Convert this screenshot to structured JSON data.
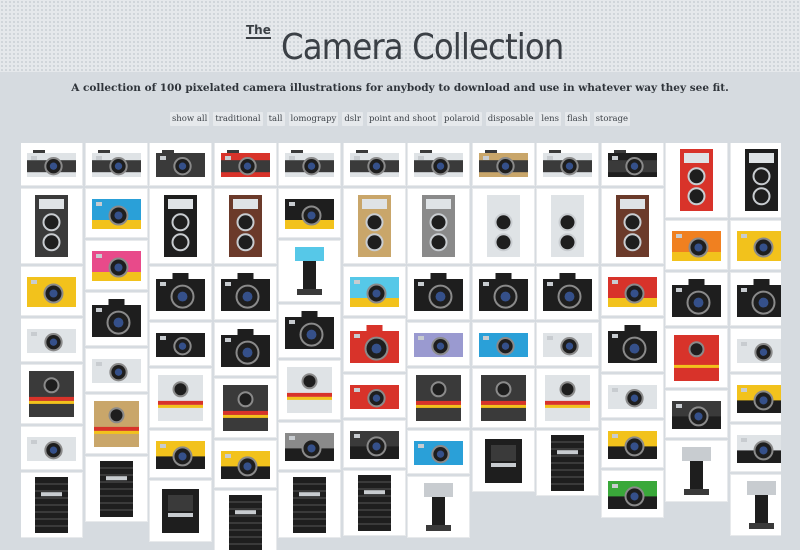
{
  "header": {
    "title_prefix": "The",
    "title": "Camera Collection",
    "tagline": "A collection of 100 pixelated camera illustrations for anybody to download and use in whatever way they see fit."
  },
  "filters": [
    "show all",
    "traditional",
    "tall",
    "lomograpy",
    "dslr",
    "point and shoot",
    "polaroid",
    "disposable",
    "lens",
    "flash",
    "storage"
  ],
  "colors": {
    "black": "#1e1e1e",
    "dark": "#3a3a3a",
    "gray": "#8a8a8a",
    "light": "#c8ccd0",
    "silver": "#dfe3e6",
    "blue": "#2aa0d8",
    "cyan": "#56c8e8",
    "red": "#d8332a",
    "orange": "#f08020",
    "yellow": "#f2c21c",
    "pink": "#e84a8a",
    "green": "#3aa83a",
    "beige": "#c9a66a",
    "brown": "#6b3a2a",
    "lavender": "#9a9ad0"
  },
  "gallery": {
    "columns": [
      [
        {
          "k": "rangefinder",
          "c": "silver"
        },
        {
          "k": "tlr",
          "c": "dark"
        },
        {
          "k": "lomo",
          "c": "yellow"
        },
        {
          "k": "pns",
          "c": "silver"
        },
        {
          "k": "polaroid",
          "c": "dark"
        },
        {
          "k": "pns",
          "c": "silver"
        },
        {
          "k": "lens",
          "c": "black"
        }
      ],
      [
        {
          "k": "rangefinder",
          "c": "silver"
        },
        {
          "k": "lomo",
          "c": "blue"
        },
        {
          "k": "lomo",
          "c": "pink"
        },
        {
          "k": "dslr",
          "c": "black"
        },
        {
          "k": "pns",
          "c": "silver"
        },
        {
          "k": "polaroid",
          "c": "beige"
        },
        {
          "k": "lens",
          "c": "black"
        }
      ],
      [
        {
          "k": "rangefinder",
          "c": "dark"
        },
        {
          "k": "tlr",
          "c": "black"
        },
        {
          "k": "dslr",
          "c": "black"
        },
        {
          "k": "pns",
          "c": "black"
        },
        {
          "k": "polaroid",
          "c": "silver"
        },
        {
          "k": "disposable",
          "c": "yellow"
        },
        {
          "k": "storage",
          "c": "black"
        }
      ],
      [
        {
          "k": "rangefinder",
          "c": "red"
        },
        {
          "k": "tlr",
          "c": "brown"
        },
        {
          "k": "dslr",
          "c": "black"
        },
        {
          "k": "dslr",
          "c": "black"
        },
        {
          "k": "polaroid",
          "c": "dark"
        },
        {
          "k": "disposable",
          "c": "yellow"
        },
        {
          "k": "lens",
          "c": "black"
        }
      ],
      [
        {
          "k": "rangefinder",
          "c": "silver"
        },
        {
          "k": "lomo",
          "c": "black"
        },
        {
          "k": "flash",
          "c": "cyan"
        },
        {
          "k": "dslr",
          "c": "black"
        },
        {
          "k": "polaroid",
          "c": "silver"
        },
        {
          "k": "disposable",
          "c": "gray"
        },
        {
          "k": "lens",
          "c": "black"
        }
      ],
      [
        {
          "k": "rangefinder",
          "c": "silver"
        },
        {
          "k": "tlr",
          "c": "beige"
        },
        {
          "k": "lomo",
          "c": "cyan"
        },
        {
          "k": "dslr",
          "c": "red"
        },
        {
          "k": "pns",
          "c": "red"
        },
        {
          "k": "disposable",
          "c": "dark"
        },
        {
          "k": "lens",
          "c": "black"
        }
      ],
      [
        {
          "k": "rangefinder",
          "c": "silver"
        },
        {
          "k": "tlr",
          "c": "gray"
        },
        {
          "k": "dslr",
          "c": "black"
        },
        {
          "k": "pns",
          "c": "lavender"
        },
        {
          "k": "polaroid",
          "c": "dark"
        },
        {
          "k": "pns",
          "c": "blue"
        },
        {
          "k": "flash",
          "c": "black"
        }
      ],
      [
        {
          "k": "rangefinder",
          "c": "beige"
        },
        {
          "k": "tlr",
          "c": "silver"
        },
        {
          "k": "dslr",
          "c": "black"
        },
        {
          "k": "pns",
          "c": "blue"
        },
        {
          "k": "polaroid",
          "c": "dark"
        },
        {
          "k": "storage",
          "c": "black"
        }
      ],
      [
        {
          "k": "rangefinder",
          "c": "silver"
        },
        {
          "k": "tlr",
          "c": "silver"
        },
        {
          "k": "dslr",
          "c": "black"
        },
        {
          "k": "pns",
          "c": "silver"
        },
        {
          "k": "polaroid",
          "c": "silver"
        },
        {
          "k": "lens",
          "c": "black"
        }
      ],
      [
        {
          "k": "rangefinder",
          "c": "black"
        },
        {
          "k": "tlr",
          "c": "brown"
        },
        {
          "k": "lomo",
          "c": "red"
        },
        {
          "k": "dslr",
          "c": "black"
        },
        {
          "k": "pns",
          "c": "silver"
        },
        {
          "k": "disposable",
          "c": "yellow"
        },
        {
          "k": "disposable",
          "c": "green"
        }
      ],
      [
        {
          "k": "tlr",
          "c": "red"
        },
        {
          "k": "lomo",
          "c": "orange"
        },
        {
          "k": "dslr",
          "c": "black"
        },
        {
          "k": "polaroid",
          "c": "red"
        },
        {
          "k": "disposable",
          "c": "dark"
        },
        {
          "k": "flash",
          "c": "black"
        }
      ],
      [
        {
          "k": "tlr",
          "c": "black"
        },
        {
          "k": "lomo",
          "c": "yellow"
        },
        {
          "k": "dslr",
          "c": "black"
        },
        {
          "k": "pns",
          "c": "silver"
        },
        {
          "k": "disposable",
          "c": "yellow"
        },
        {
          "k": "disposable",
          "c": "silver"
        },
        {
          "k": "flash",
          "c": "black"
        }
      ]
    ]
  }
}
